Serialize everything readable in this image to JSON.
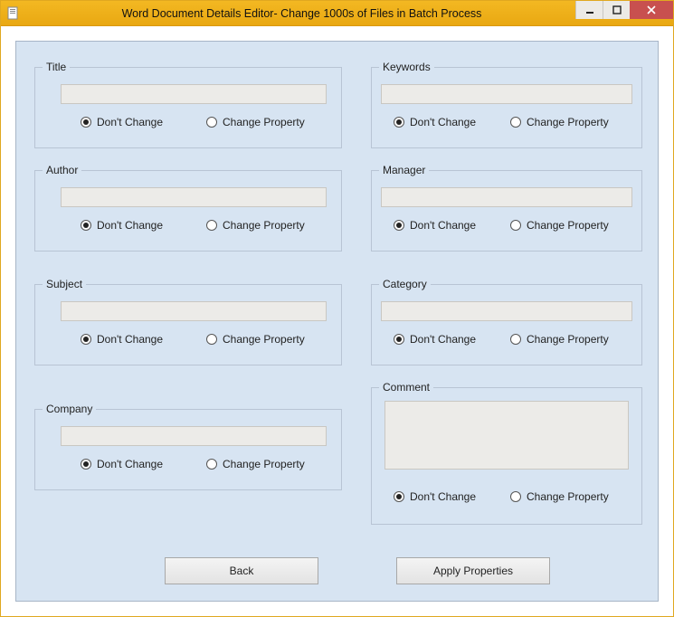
{
  "window": {
    "title": "Word Document Details Editor- Change 1000s of Files in Batch Process"
  },
  "labels": {
    "dont_change": "Don't Change",
    "change_property": "Change Property"
  },
  "groups": {
    "title": {
      "label": "Title",
      "value": "",
      "selected": "dont_change"
    },
    "author": {
      "label": "Author",
      "value": "",
      "selected": "dont_change"
    },
    "subject": {
      "label": "Subject",
      "value": "",
      "selected": "dont_change"
    },
    "company": {
      "label": "Company",
      "value": "",
      "selected": "dont_change"
    },
    "keywords": {
      "label": "Keywords",
      "value": "",
      "selected": "dont_change"
    },
    "manager": {
      "label": "Manager",
      "value": "",
      "selected": "dont_change"
    },
    "category": {
      "label": "Category",
      "value": "",
      "selected": "dont_change"
    },
    "comment": {
      "label": "Comment",
      "value": "",
      "selected": "dont_change"
    }
  },
  "buttons": {
    "back": "Back",
    "apply": "Apply Properties"
  }
}
